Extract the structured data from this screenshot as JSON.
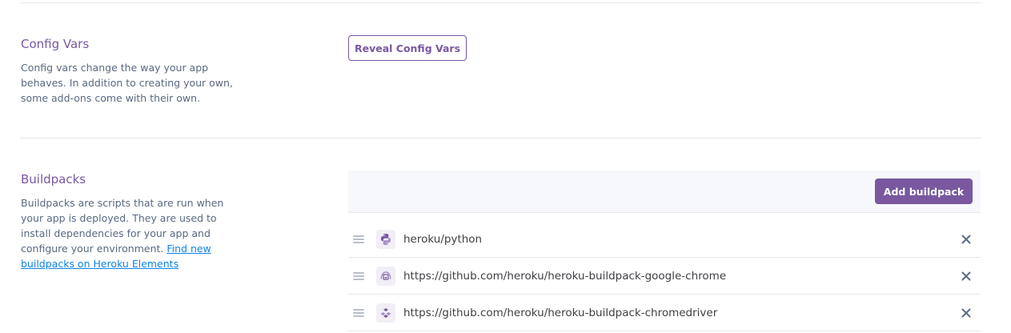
{
  "config_vars": {
    "title": "Config Vars",
    "description": "Config vars change the way your app behaves. In addition to creating your own, some add-ons come with their own.",
    "reveal_button": "Reveal Config Vars"
  },
  "buildpacks": {
    "title": "Buildpacks",
    "description": "Buildpacks are scripts that are run when your app is deployed. They are used to install dependencies for your app and configure your environment.",
    "link_text": "Find new buildpacks on Heroku Elements",
    "add_button": "Add buildpack",
    "items": [
      {
        "name": "heroku/python",
        "icon": "python-icon"
      },
      {
        "name": "https://github.com/heroku/heroku-buildpack-google-chrome",
        "icon": "chrome-buildpack-icon"
      },
      {
        "name": "https://github.com/heroku/heroku-buildpack-chromedriver",
        "icon": "chromedriver-buildpack-icon"
      }
    ]
  },
  "colors": {
    "accent": "#79589f",
    "link": "#0e82e6",
    "muted_text": "#596981",
    "divider": "#e7e7ee"
  }
}
